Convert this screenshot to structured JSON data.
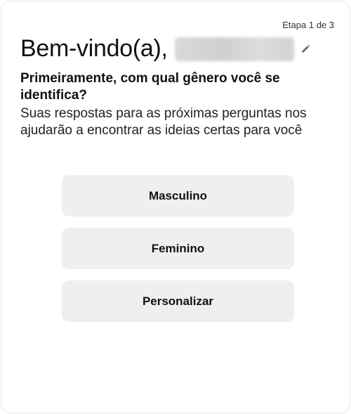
{
  "header": {
    "step_label": "Etapa 1 de 3",
    "welcome": "Bem-vindo(a),",
    "edit_icon": "pencil-icon"
  },
  "main": {
    "question": "Primeiramente, com qual gênero você se identifica?",
    "subtitle": "Suas respostas para as próximas perguntas nos ajudarão a encontrar as ideias certas para você",
    "options": [
      {
        "label": "Masculino"
      },
      {
        "label": "Feminino"
      },
      {
        "label": "Personalizar"
      }
    ]
  }
}
